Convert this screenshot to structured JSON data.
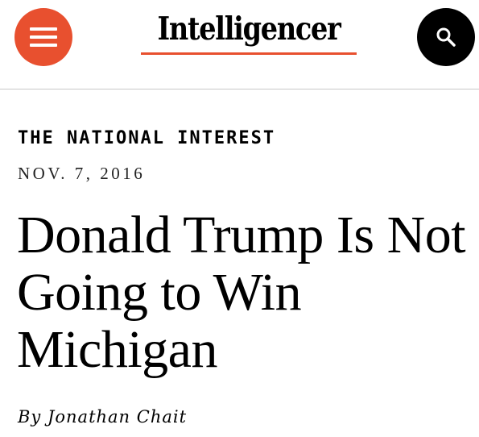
{
  "header": {
    "logo_text": "Intelligencer",
    "menu_icon": "hamburger-menu-icon",
    "search_icon": "search-icon",
    "colors": {
      "accent": "#e8502f",
      "search_button": "#000000"
    }
  },
  "article": {
    "rubric": "THE NATIONAL INTEREST",
    "date": "NOV. 7, 2016",
    "headline": "Donald Trump Is Not Going to Win Michigan",
    "byline": "By Jonathan Chait"
  }
}
